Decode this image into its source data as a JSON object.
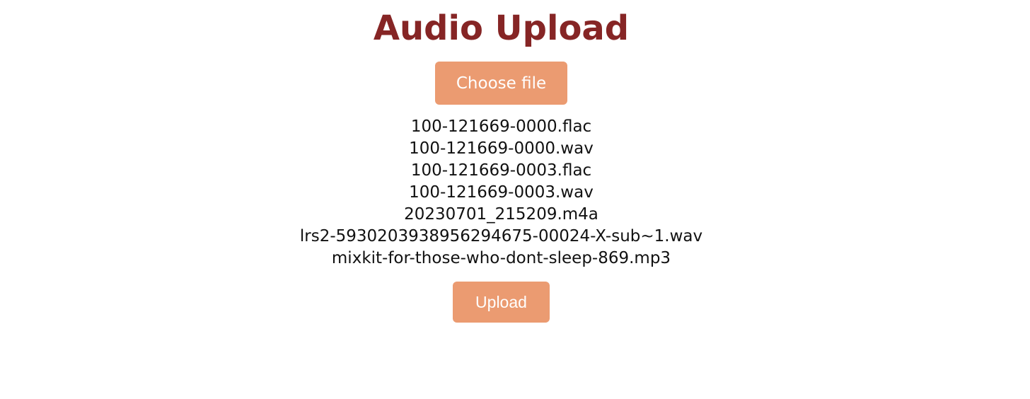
{
  "page": {
    "title": "Audio Upload"
  },
  "picker": {
    "choose_label": "Choose file"
  },
  "files": [
    "100-121669-0000.flac",
    "100-121669-0000.wav",
    "100-121669-0003.flac",
    "100-121669-0003.wav",
    "20230701_215209.m4a",
    "lrs2-5930203938956294675-00024-X-sub~1.wav",
    "mixkit-for-those-who-dont-sleep-869.mp3"
  ],
  "actions": {
    "upload_label": "Upload"
  },
  "colors": {
    "title": "#862525",
    "button_bg": "#eb9b71",
    "button_text": "#ffffff"
  }
}
